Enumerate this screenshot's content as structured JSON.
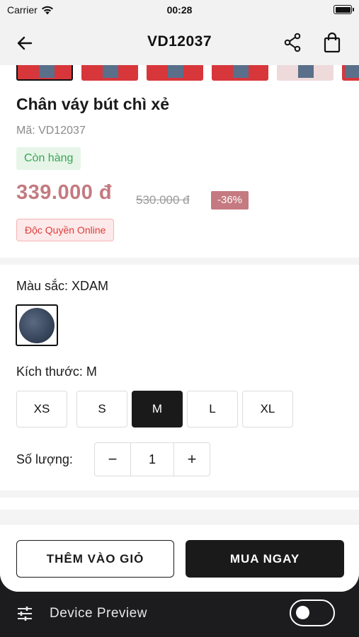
{
  "status_bar": {
    "carrier": "Carrier",
    "time": "00:28"
  },
  "header": {
    "title": "VD12037",
    "icons": [
      "back-arrow-icon",
      "share-icon",
      "shopping-bag-icon"
    ]
  },
  "product": {
    "name": "Chân váy bút chì xẻ",
    "sku": "Mã: VD12037",
    "stock": "Còn hàng",
    "price": "339.000 đ",
    "old_price": "530.000 đ",
    "discount": "-36%",
    "exclusive_badge": "Độc Quyền Online",
    "accent_color": "#c47a80"
  },
  "options": {
    "color_label": "Màu sắc: XDAM",
    "size_label": "Kích thước: M",
    "sizes": [
      "XS",
      "S",
      "M",
      "L",
      "XL"
    ],
    "selected_size": "M",
    "quantity_label": "Số lượng:",
    "quantity": "1",
    "minus": "−",
    "plus": "+"
  },
  "actions": {
    "add_to_cart": "THÊM VÀO GIỎ",
    "buy_now": "MUA NGAY"
  },
  "device_preview": {
    "label": "Device Preview",
    "toggle_on": false
  }
}
